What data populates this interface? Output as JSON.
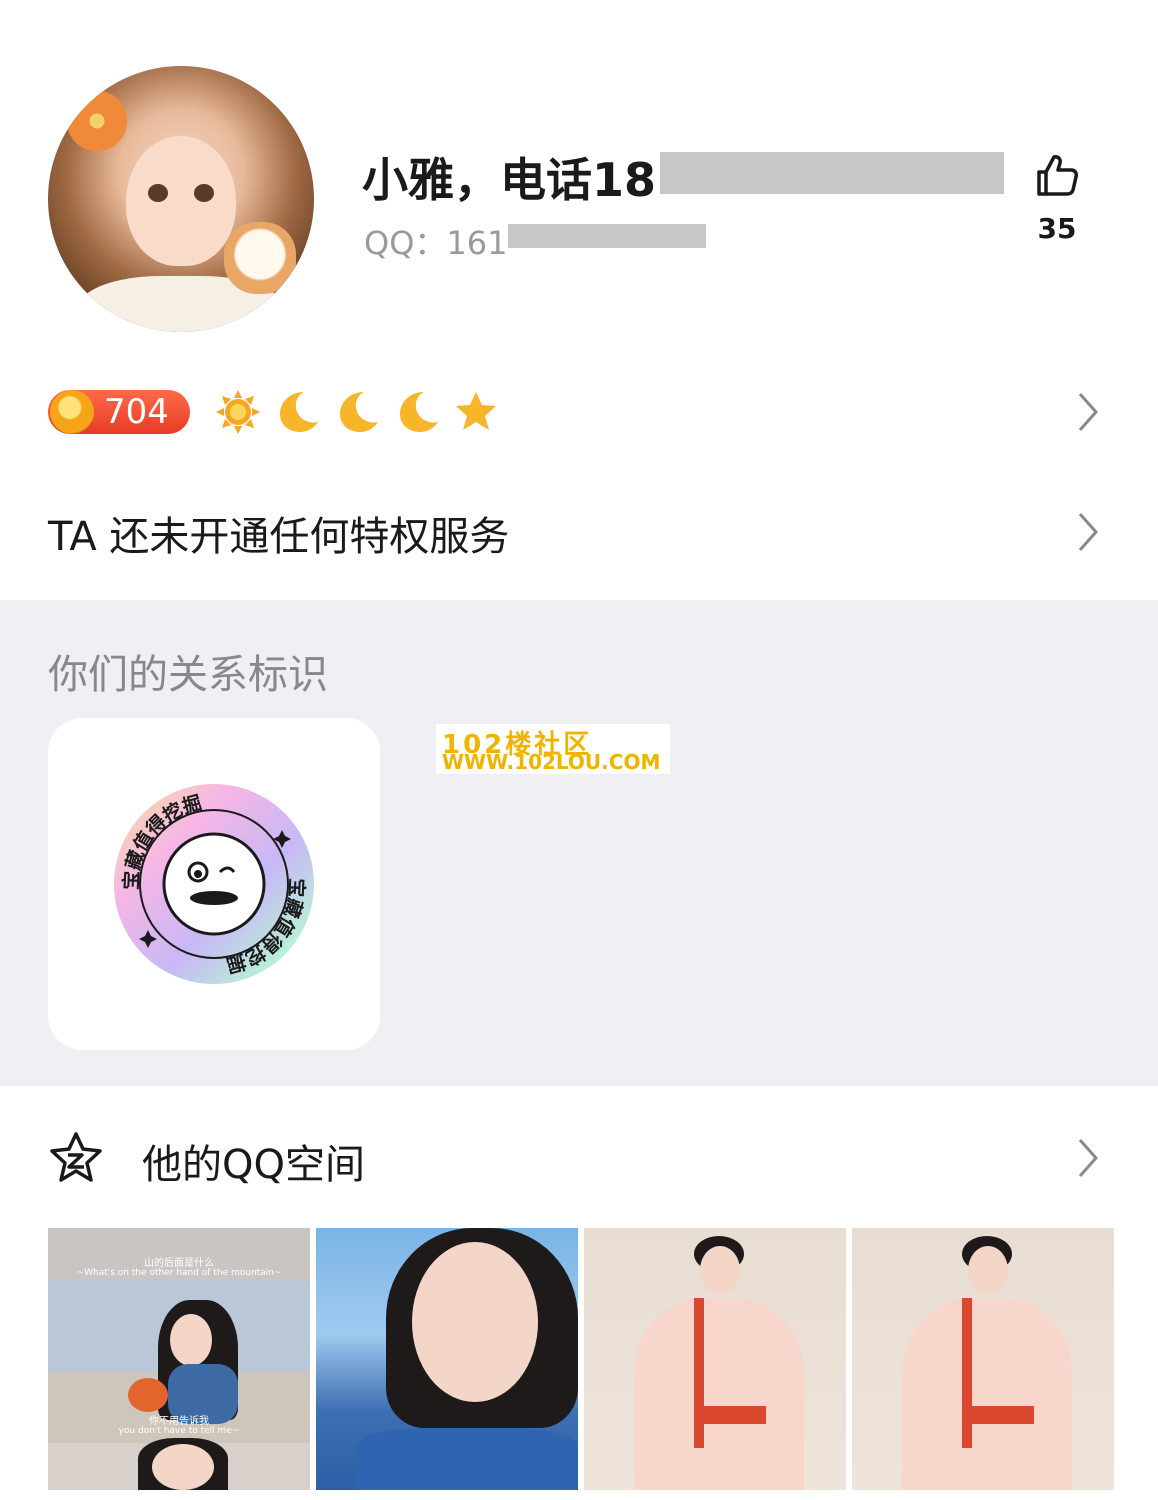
{
  "profile": {
    "name": "小雅，电话18",
    "qq": "QQ：161",
    "like_count": "35"
  },
  "level": {
    "value": "704",
    "icons": [
      "sun-icon",
      "moon-icon",
      "moon-icon",
      "moon-icon",
      "star-icon"
    ]
  },
  "privilege": {
    "text": "TA 还未开通任何特权服务"
  },
  "relation": {
    "title": "你们的关系标识",
    "badge_text": "宝藏值得挖掘"
  },
  "watermark": {
    "title": "102楼社区",
    "url": "WWW.102LOU.COM"
  },
  "qzone": {
    "title": "他的QQ空间",
    "photo1_caption_top": "山的后面是什么",
    "photo1_caption_top_en": "~What's on the other hand of the mountain~",
    "photo1_caption_mid": "你不用告诉我",
    "photo1_caption_mid_en": "you don't have to tell me~"
  },
  "colors": {
    "accent_red": "#e83b25",
    "section_bg": "#efeff4",
    "watermark": "#f0b400"
  }
}
